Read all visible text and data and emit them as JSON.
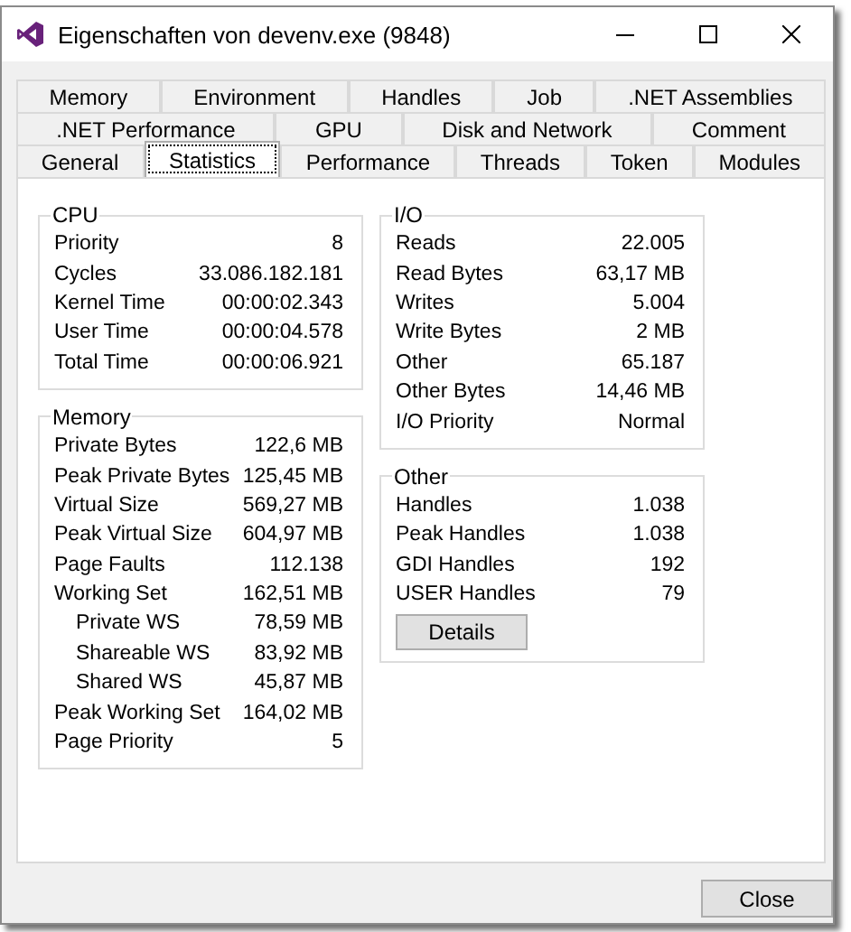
{
  "window": {
    "title": "Eigenschaften von devenv.exe (9848)"
  },
  "tab_rows": [
    [
      {
        "label": "Memory",
        "selected": false
      },
      {
        "label": "Environment",
        "selected": false
      },
      {
        "label": "Handles",
        "selected": false
      },
      {
        "label": "Job",
        "selected": false
      },
      {
        "label": ".NET Assemblies",
        "selected": false
      }
    ],
    [
      {
        "label": ".NET Performance",
        "selected": false
      },
      {
        "label": "GPU",
        "selected": false
      },
      {
        "label": "Disk and Network",
        "selected": false
      },
      {
        "label": "Comment",
        "selected": false
      }
    ],
    [
      {
        "label": "General",
        "selected": false
      },
      {
        "label": "Statistics",
        "selected": true
      },
      {
        "label": "Performance",
        "selected": false
      },
      {
        "label": "Threads",
        "selected": false
      },
      {
        "label": "Token",
        "selected": false
      },
      {
        "label": "Modules",
        "selected": false
      }
    ]
  ],
  "columns": [
    [
      {
        "title": "CPU",
        "rows": [
          {
            "label": "Priority",
            "value": "8"
          },
          {
            "label": "Cycles",
            "value": "33.086.182.181"
          },
          {
            "label": "Kernel Time",
            "value": "00:00:02.343"
          },
          {
            "label": "User Time",
            "value": "00:00:04.578"
          },
          {
            "label": "Total Time",
            "value": "00:00:06.921"
          }
        ]
      },
      {
        "title": "Memory",
        "rows": [
          {
            "label": "Private Bytes",
            "value": "122,6 MB"
          },
          {
            "label": "Peak Private Bytes",
            "value": "125,45 MB"
          },
          {
            "label": "Virtual Size",
            "value": "569,27 MB"
          },
          {
            "label": "Peak Virtual Size",
            "value": "604,97 MB"
          },
          {
            "label": "Page Faults",
            "value": "112.138"
          },
          {
            "label": "Working Set",
            "value": "162,51 MB",
            "children": [
              {
                "label": "Private WS",
                "value": "78,59 MB"
              },
              {
                "label": "Shareable WS",
                "value": "83,92 MB"
              },
              {
                "label": "Shared WS",
                "value": "45,87 MB"
              }
            ]
          },
          {
            "label": "Peak Working Set",
            "value": "164,02 MB"
          },
          {
            "label": "Page Priority",
            "value": "5"
          }
        ]
      }
    ],
    [
      {
        "title": "I/O",
        "rows": [
          {
            "label": "Reads",
            "value": "22.005"
          },
          {
            "label": "Read Bytes",
            "value": "63,17 MB"
          },
          {
            "label": "Writes",
            "value": "5.004"
          },
          {
            "label": "Write Bytes",
            "value": "2 MB"
          },
          {
            "label": "Other",
            "value": "65.187"
          },
          {
            "label": "Other Bytes",
            "value": "14,46 MB"
          },
          {
            "label": "I/O Priority",
            "value": "Normal"
          }
        ]
      },
      {
        "title": "Other",
        "rows": [
          {
            "label": "Handles",
            "value": "1.038"
          },
          {
            "label": "Peak Handles",
            "value": "1.038"
          },
          {
            "label": "GDI Handles",
            "value": "192"
          },
          {
            "label": "USER Handles",
            "value": "79"
          }
        ],
        "button": "Details"
      }
    ]
  ],
  "close_button": "Close"
}
